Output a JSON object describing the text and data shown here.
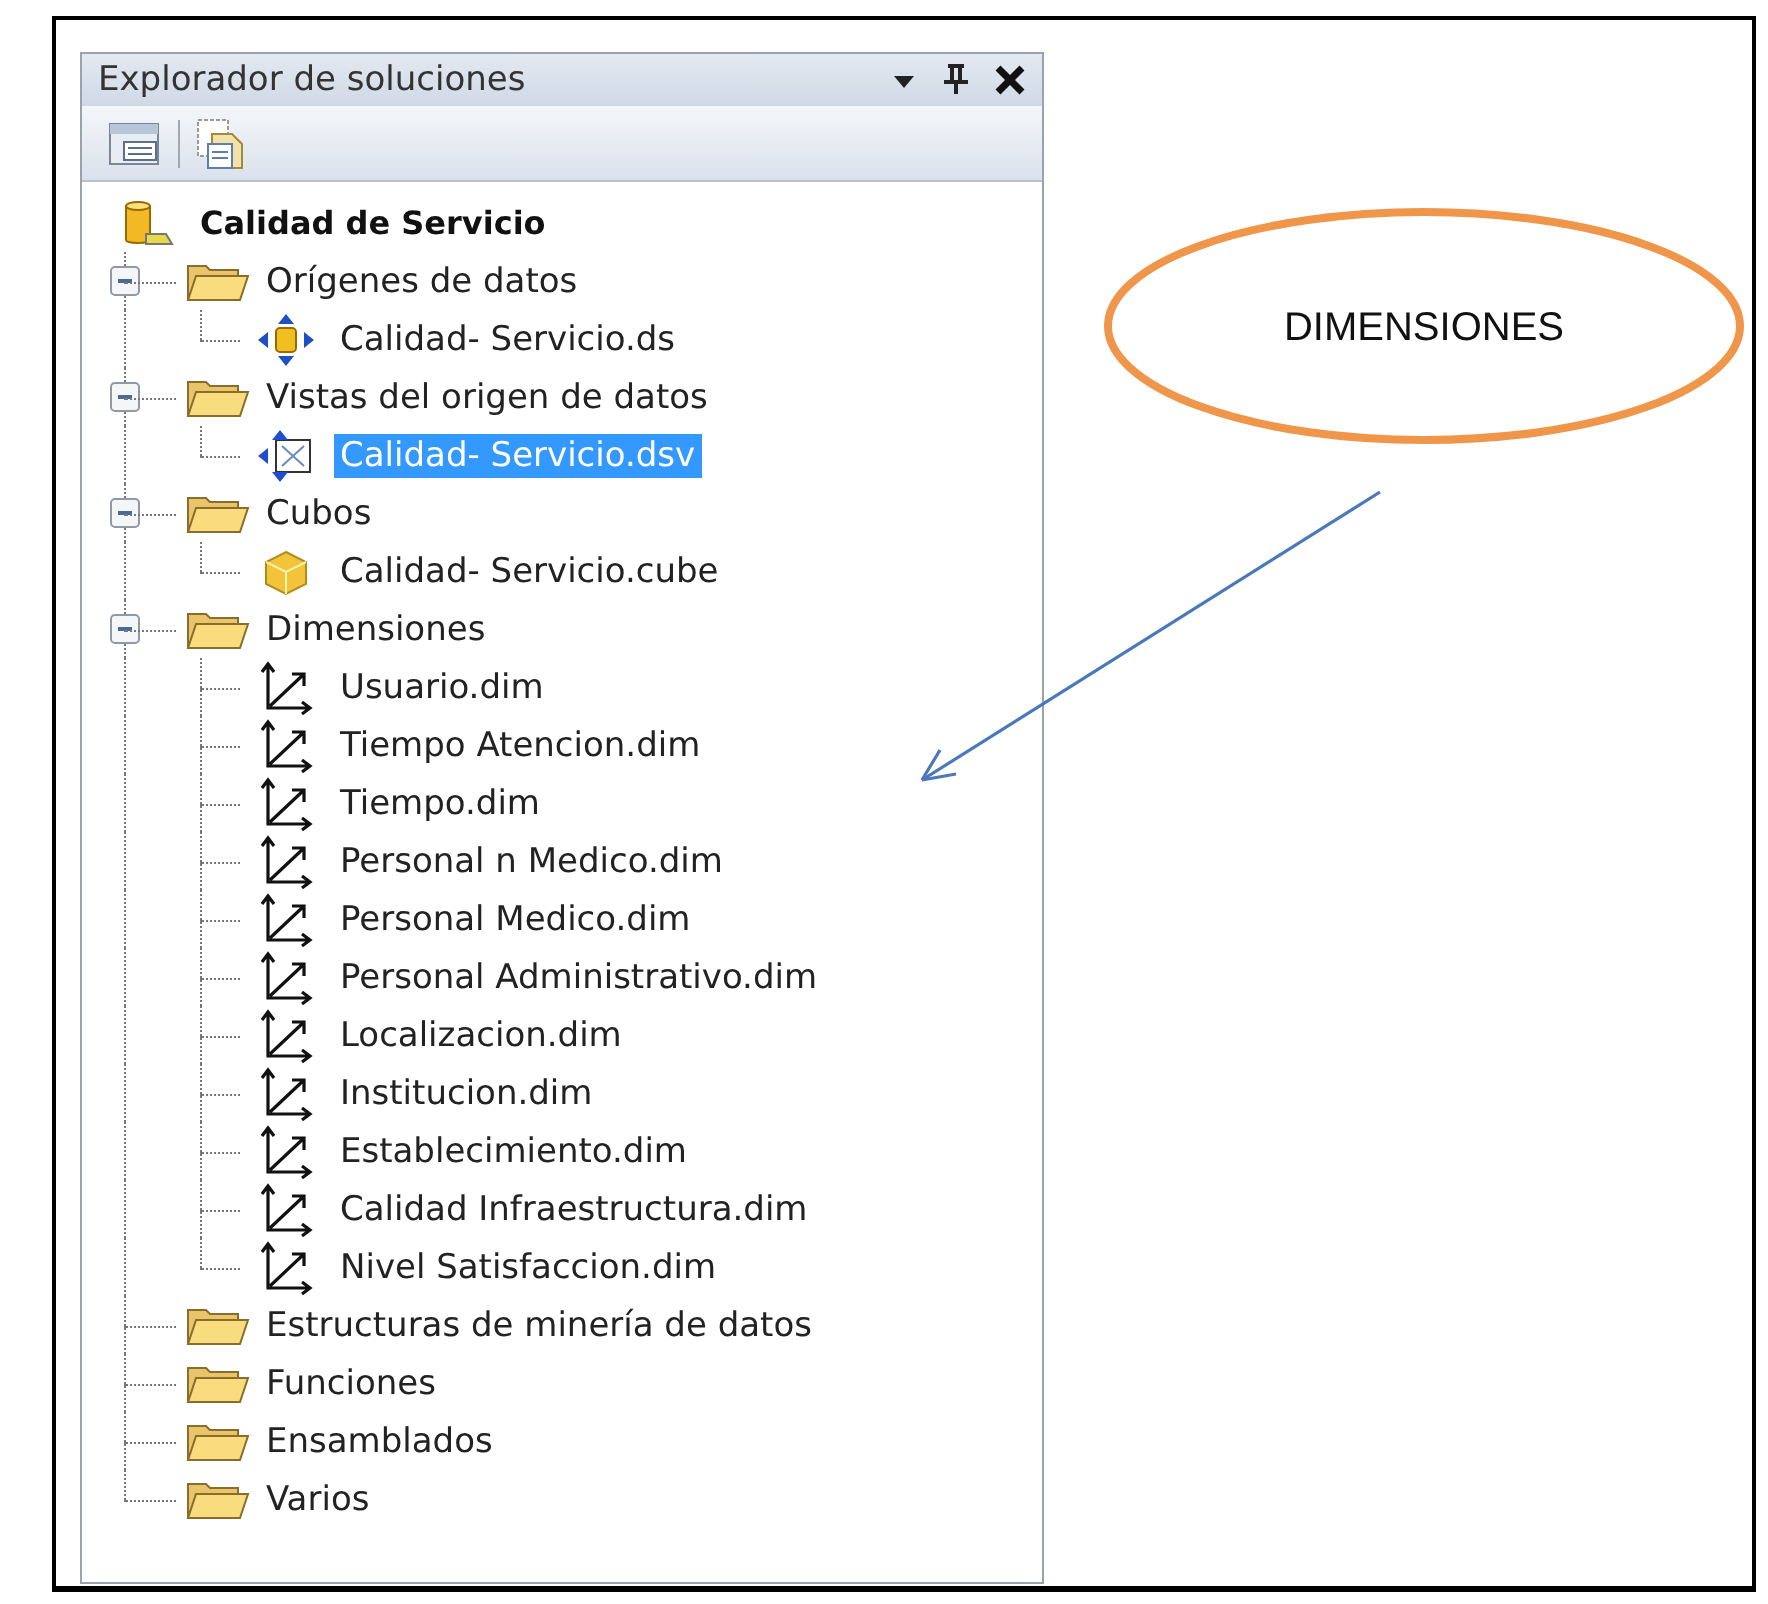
{
  "panel": {
    "title": "Explorador de soluciones"
  },
  "tree": {
    "label": "Calidad de Servicio",
    "children": [
      {
        "label": "Orígenes de datos",
        "expanded": true,
        "children": [
          {
            "label": "Calidad- Servicio.ds",
            "kind": "datasource",
            "selected": false
          }
        ]
      },
      {
        "label": "Vistas del origen de datos",
        "expanded": true,
        "children": [
          {
            "label": "Calidad- Servicio.dsv",
            "kind": "dsv",
            "selected": true
          }
        ]
      },
      {
        "label": "Cubos",
        "expanded": true,
        "children": [
          {
            "label": "Calidad- Servicio.cube",
            "kind": "cube",
            "selected": false
          }
        ]
      },
      {
        "label": "Dimensiones",
        "expanded": true,
        "children": [
          {
            "label": "Usuario.dim",
            "kind": "dimension",
            "selected": false
          },
          {
            "label": "Tiempo Atencion.dim",
            "kind": "dimension",
            "selected": false
          },
          {
            "label": "Tiempo.dim",
            "kind": "dimension",
            "selected": false
          },
          {
            "label": "Personal n Medico.dim",
            "kind": "dimension",
            "selected": false
          },
          {
            "label": "Personal Medico.dim",
            "kind": "dimension",
            "selected": false
          },
          {
            "label": "Personal Administrativo.dim",
            "kind": "dimension",
            "selected": false
          },
          {
            "label": "Localizacion.dim",
            "kind": "dimension",
            "selected": false
          },
          {
            "label": "Institucion.dim",
            "kind": "dimension",
            "selected": false
          },
          {
            "label": "Establecimiento.dim",
            "kind": "dimension",
            "selected": false
          },
          {
            "label": "Calidad Infraestructura.dim",
            "kind": "dimension",
            "selected": false
          },
          {
            "label": "Nivel Satisfaccion.dim",
            "kind": "dimension",
            "selected": false
          }
        ]
      },
      {
        "label": "Estructuras de minería de datos"
      },
      {
        "label": "Funciones"
      },
      {
        "label": "Ensamblados"
      },
      {
        "label": "Varios"
      }
    ]
  },
  "callout": {
    "text": "DIMENSIONES"
  }
}
